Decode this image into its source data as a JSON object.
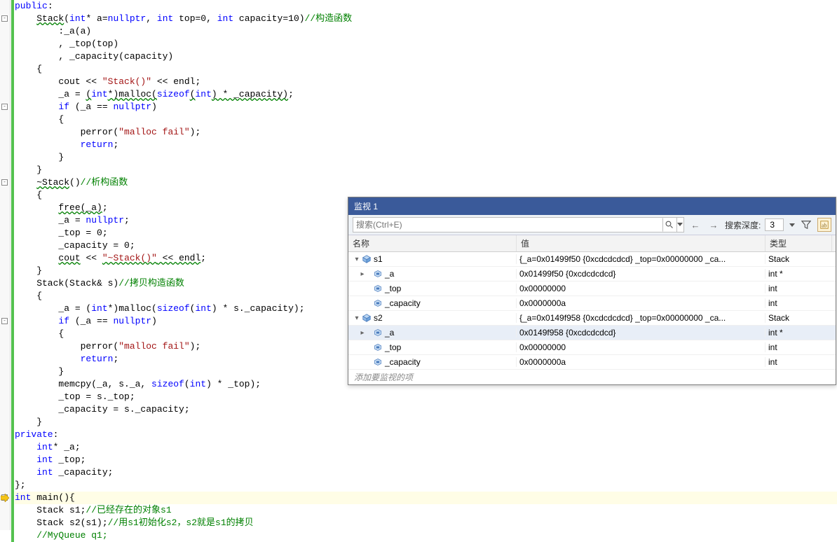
{
  "code": {
    "lines": [
      {
        "html": "<span class='kw'>public</span>:"
      },
      {
        "html": "    <span class='err-underline'>Stack</span>(<span class='kw'>int</span>* a=<span class='kw'>nullptr</span>, <span class='kw'>int</span> top=0, <span class='kw'>int</span> capacity=10)<span class='cmt'>//构造函数</span>"
      },
      {
        "html": "        :_a(a)"
      },
      {
        "html": "        , _top(top)"
      },
      {
        "html": "        , _capacity(capacity)"
      },
      {
        "html": "    {"
      },
      {
        "html": "        cout &lt;&lt; <span class='str'>&quot;Stack()&quot;</span> &lt;&lt; endl;"
      },
      {
        "html": "        _a = <span class='err-underline'>(</span><span class='kw'>int</span><span class='err-underline'>*)malloc(</span><span class='kw'>sizeof</span><span class='err-underline'>(</span><span class='kw'>int</span><span class='err-underline'>) * _capacity)</span>;"
      },
      {
        "html": "        <span class='kw'>if</span> (_a == <span class='kw'>nullptr</span>)"
      },
      {
        "html": "        {"
      },
      {
        "html": "            perror(<span class='str'>&quot;malloc fail&quot;</span>);"
      },
      {
        "html": "            <span class='kw'>return</span>;"
      },
      {
        "html": "        }"
      },
      {
        "html": "    }"
      },
      {
        "html": "    <span class='err-underline'>~Stack</span>()<span class='cmt'>//析构函数</span>"
      },
      {
        "html": "    {"
      },
      {
        "html": "        <span class='err-underline'>free(_a)</span>;"
      },
      {
        "html": "        _a = <span class='kw'>nullptr</span>;"
      },
      {
        "html": "        _top = 0;"
      },
      {
        "html": "        _capacity = 0;"
      },
      {
        "html": "        <span class='err-underline'>cout</span> &lt;&lt; <span class='err-underline'><span class='str'>&quot;~Stack()&quot;</span> &lt;&lt; endl</span>;"
      },
      {
        "html": "    }"
      },
      {
        "html": "    Stack(Stack&amp; s)<span class='cmt'>//拷贝构造函数</span>"
      },
      {
        "html": "    {"
      },
      {
        "html": "        _a = (<span class='kw'>int</span>*)malloc(<span class='kw'>sizeof</span>(<span class='kw'>int</span>) * s._capacity);"
      },
      {
        "html": "        <span class='kw'>if</span> (_a == <span class='kw'>nullptr</span>)"
      },
      {
        "html": "        {"
      },
      {
        "html": "            perror(<span class='str'>&quot;malloc fail&quot;</span>);"
      },
      {
        "html": "            <span class='kw'>return</span>;"
      },
      {
        "html": "        }"
      },
      {
        "html": "        memcpy(_a, s._a, <span class='kw'>sizeof</span>(<span class='kw'>int</span>) * _top);"
      },
      {
        "html": "        _top = s._top;"
      },
      {
        "html": "        _capacity = s._capacity;"
      },
      {
        "html": "    }"
      },
      {
        "html": "<span class='kw'>private</span>:"
      },
      {
        "html": "    <span class='kw'>int</span>* _a;"
      },
      {
        "html": "    <span class='kw'>int</span> _top;"
      },
      {
        "html": "    <span class='kw'>int</span> _capacity;"
      },
      {
        "html": "};"
      },
      {
        "html": "<span class='kw'>int</span> main(){",
        "hl": true
      },
      {
        "html": "    Stack s1;<span class='cmt'>//已经存在的对象s1</span>"
      },
      {
        "html": "    Stack s2(s1);<span class='cmt'>//用s1初始化s2，s2就是s1的拷贝</span>"
      },
      {
        "html": "<span class='cmt'>    //MyQueue q1;</span>"
      }
    ],
    "fold_lines": [
      1,
      8,
      14,
      25,
      39
    ],
    "exec_line": 39,
    "green_bars": [
      [
        0,
        43
      ]
    ]
  },
  "watch": {
    "title": "监视 1",
    "search_placeholder": "搜索(Ctrl+E)",
    "depth_label": "搜索深度:",
    "depth_value": "3",
    "headers": {
      "name": "名称",
      "value": "值",
      "type": "类型"
    },
    "rows": [
      {
        "indent": 0,
        "expander": "down",
        "icon": "cube",
        "name": "s1",
        "value": "{_a=0x01499f50 {0xcdcdcdcd} _top=0x00000000 _ca...",
        "type": "Stack"
      },
      {
        "indent": 1,
        "expander": "right",
        "icon": "field",
        "name": "_a",
        "value": "0x01499f50 {0xcdcdcdcd}",
        "type": "int *"
      },
      {
        "indent": 1,
        "expander": "",
        "icon": "field",
        "name": "_top",
        "value": "0x00000000",
        "type": "int"
      },
      {
        "indent": 1,
        "expander": "",
        "icon": "field",
        "name": "_capacity",
        "value": "0x0000000a",
        "type": "int"
      },
      {
        "indent": 0,
        "expander": "down",
        "icon": "cube",
        "name": "s2",
        "value": "{_a=0x0149f958 {0xcdcdcdcd} _top=0x00000000 _ca...",
        "type": "Stack"
      },
      {
        "indent": 1,
        "expander": "right",
        "icon": "field",
        "name": "_a",
        "value": "0x0149f958 {0xcdcdcdcd}",
        "type": "int *",
        "selected": true
      },
      {
        "indent": 1,
        "expander": "",
        "icon": "field",
        "name": "_top",
        "value": "0x00000000",
        "type": "int"
      },
      {
        "indent": 1,
        "expander": "",
        "icon": "field",
        "name": "_capacity",
        "value": "0x0000000a",
        "type": "int"
      }
    ],
    "placeholder": "添加要监视的项"
  }
}
